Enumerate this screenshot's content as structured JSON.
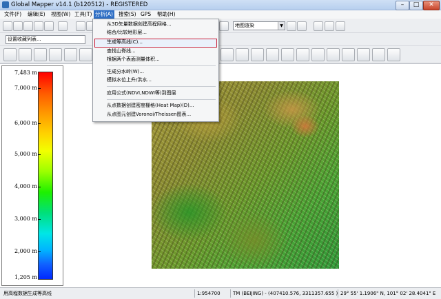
{
  "window": {
    "title": "Global Mapper v14.1 (b120512) - REGISTERED"
  },
  "menubar": [
    "文件(F)",
    "编辑(E)",
    "视图(W)",
    "工具(T)",
    "分析(A)",
    "搜索(S)",
    "GPS",
    "帮助(H)"
  ],
  "toolbar": {
    "layer_combo": "设置收藏列表...",
    "map_combo": "地图渲染"
  },
  "dropdown": {
    "items": [
      "从3D矢量数据创建高程网格...",
      "结合/比较地形层...",
      "生成等高线(C)...",
      "查找山脊线...",
      "根据两个表面测量体积...",
      "生成分水岭(W)...",
      "模拟水位上升/洪水...",
      "应用公式(NDVI,NDWI等)到图层",
      "从点数据创建密度栅格(Heat Map)(D)...",
      "从点图元创建Voronoi/Theissen图表..."
    ]
  },
  "legend": {
    "ticks": [
      "7,483 m",
      "7,000 m",
      "6,000 m",
      "5,000 m",
      "4,000 m",
      "3,000 m",
      "2,000 m",
      "1,205 m"
    ],
    "colors": [
      "#ff0000",
      "#ff9a00",
      "#f2ff00",
      "#1ef000",
      "#00e6e6",
      "#0028ff"
    ]
  },
  "statusbar": {
    "message": "用高程数据生成等高线",
    "scale": "1:954700",
    "projection": "TM (BEIJING) - (407410.576, 3311357.655 )",
    "coords": "29° 55' 1.1906\" N, 101° 02' 28.4041\" E"
  }
}
